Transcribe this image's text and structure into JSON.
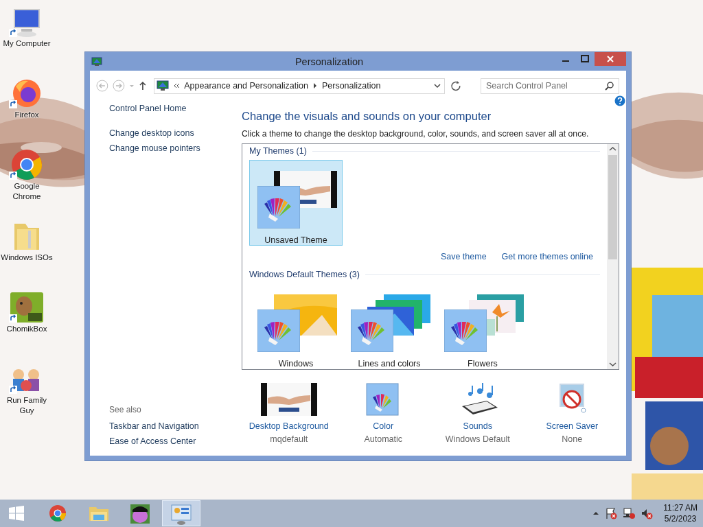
{
  "desktop_icons": [
    {
      "label": "My Computer",
      "kind": "computer"
    },
    {
      "label": "Firefox",
      "kind": "firefox"
    },
    {
      "label": "Google Chrome",
      "kind": "chrome"
    },
    {
      "label": "Windows ISOs",
      "kind": "folder"
    },
    {
      "label": "ChomikBox",
      "kind": "box"
    },
    {
      "label": "Run Family Guy",
      "kind": "game"
    }
  ],
  "window": {
    "title": "Personalization",
    "address": {
      "crumbs": [
        "Appearance and Personalization",
        "Personalization"
      ]
    },
    "search": {
      "placeholder": "Search Control Panel"
    },
    "sidebar": {
      "links": [
        "Control Panel Home",
        "Change desktop icons",
        "Change mouse pointers"
      ],
      "see_also": {
        "heading": "See also",
        "links": [
          "Taskbar and Navigation",
          "Ease of Access Center"
        ]
      }
    },
    "heading": "Change the visuals and sounds on your computer",
    "description": "Click a theme to change the desktop background, color, sounds, and screen saver all at once.",
    "groups": [
      {
        "title": "My Themes (1)",
        "themes": [
          {
            "name": "Unsaved Theme",
            "selected": true,
            "kind": "handshake"
          }
        ],
        "actions": [
          "Save theme",
          "Get more themes online"
        ]
      },
      {
        "title": "Windows Default Themes (3)",
        "themes": [
          {
            "name": "Windows",
            "selected": false,
            "kind": "windows"
          },
          {
            "name": "Lines and colors",
            "selected": false,
            "kind": "lines"
          },
          {
            "name": "Flowers",
            "selected": false,
            "kind": "flowers"
          }
        ]
      }
    ],
    "settings": [
      {
        "label": "Desktop Background",
        "value": "mqdefault",
        "kind": "background"
      },
      {
        "label": "Color",
        "value": "Automatic",
        "kind": "color"
      },
      {
        "label": "Sounds",
        "value": "Windows Default",
        "kind": "sounds"
      },
      {
        "label": "Screen Saver",
        "value": "None",
        "kind": "screensaver"
      }
    ]
  },
  "taskbar": {
    "apps": [
      {
        "kind": "chrome",
        "active": false
      },
      {
        "kind": "explorer",
        "active": false
      },
      {
        "kind": "game",
        "active": false
      },
      {
        "kind": "control",
        "active": true
      }
    ],
    "time": "11:27 AM",
    "date": "5/2/2023"
  }
}
